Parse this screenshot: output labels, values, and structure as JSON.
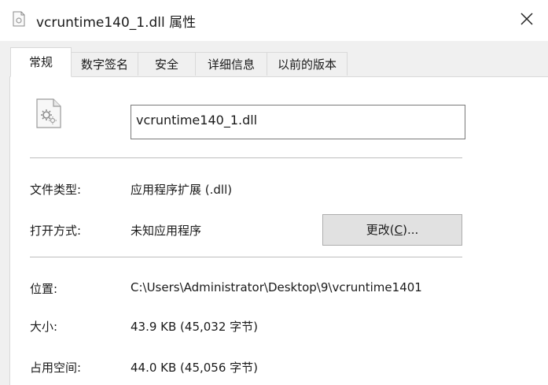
{
  "window": {
    "title": "vcruntime140_1.dll 属性",
    "close_glyph": "✕"
  },
  "tabs": [
    {
      "label": "常规",
      "active": true
    },
    {
      "label": "数字签名",
      "active": false
    },
    {
      "label": "安全",
      "active": false
    },
    {
      "label": "详细信息",
      "active": false
    },
    {
      "label": "以前的版本",
      "active": false
    }
  ],
  "general": {
    "file_name": "vcruntime140_1.dll",
    "file_type_label": "文件类型:",
    "file_type_value": "应用程序扩展 (.dll)",
    "open_with_label": "打开方式:",
    "open_with_value": "未知应用程序",
    "change_button": {
      "prefix": "更改(",
      "accel": "C",
      "suffix": ")..."
    },
    "location_label": "位置:",
    "location_value": "C:\\Users\\Administrator\\Desktop\\9\\vcruntime1401",
    "size_label": "大小:",
    "size_value": "43.9 KB (45,032 字节)",
    "size_on_disk_label": "占用空间:",
    "size_on_disk_value": "44.0 KB (45,056 字节)"
  },
  "icons": {
    "title": "dll-file-icon",
    "file": "dll-file-gear-icon",
    "close": "close-icon"
  }
}
